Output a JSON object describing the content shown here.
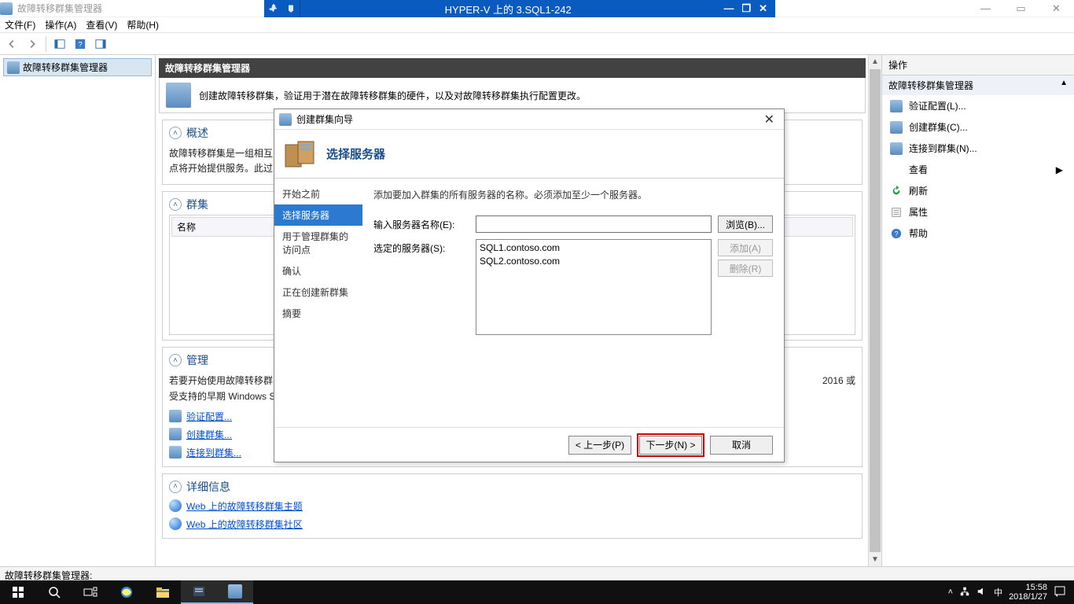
{
  "host": {
    "title": "故障转移群集管理器",
    "window_buttons": {
      "min": "—",
      "max": "▭",
      "close": "✕"
    }
  },
  "hyperv": {
    "title": "HYPER-V 上的 3.SQL1-242",
    "ctrl_min": "—",
    "ctrl_max": "❐",
    "ctrl_close": "✕"
  },
  "menu": {
    "file": "文件(F)",
    "action": "操作(A)",
    "view": "查看(V)",
    "help": "帮助(H)"
  },
  "tree": {
    "root": "故障转移群集管理器"
  },
  "center": {
    "header": "故障转移群集管理器",
    "intro": "创建故障转移群集，验证用于潜在故障转移群集的硬件，以及对故障转移群集执行配置更改。",
    "overview_h": "概述",
    "overview_body": "故障转移群集是一组相互\n点将开始提供服务。此过",
    "clusters_h": "群集",
    "clusters_col": "名称",
    "manage_h": "管理",
    "manage_body": "若要开始使用故障转移群\n受支持的早期 Windows S",
    "manage_tail": "2016 或",
    "link_validate": "验证配置...",
    "link_create": "创建群集...",
    "link_connect": "连接到群集...",
    "details_h": "详细信息",
    "link_web1": "Web 上的故障转移群集主题",
    "link_web2": "Web 上的故障转移群集社区"
  },
  "actions": {
    "pane_title": "操作",
    "group": "故障转移群集管理器",
    "validate": "验证配置(L)...",
    "create": "创建群集(C)...",
    "connect": "连接到群集(N)...",
    "view": "查看",
    "refresh": "刷新",
    "properties": "属性",
    "help": "帮助"
  },
  "wizard": {
    "title": "创建群集向导",
    "banner": "选择服务器",
    "hint": "添加要加入群集的所有服务器的名称。必须添加至少一个服务器。",
    "nav": {
      "before": "开始之前",
      "select": "选择服务器",
      "access": "用于管理群集的访问点",
      "confirm": "确认",
      "creating": "正在创建新群集",
      "summary": "摘要"
    },
    "lbl_input": "输入服务器名称(E):",
    "lbl_selected": "选定的服务器(S):",
    "input_value": "",
    "servers": [
      "SQL1.contoso.com",
      "SQL2.contoso.com"
    ],
    "btn_browse": "浏览(B)...",
    "btn_add": "添加(A)",
    "btn_remove": "删除(R)",
    "btn_prev": "< 上一步(P)",
    "btn_next": "下一步(N) >",
    "btn_cancel": "取消"
  },
  "status": "故障转移群集管理器:",
  "taskbar": {
    "time": "15:58",
    "date": "2018/1/27",
    "ime": "中"
  }
}
